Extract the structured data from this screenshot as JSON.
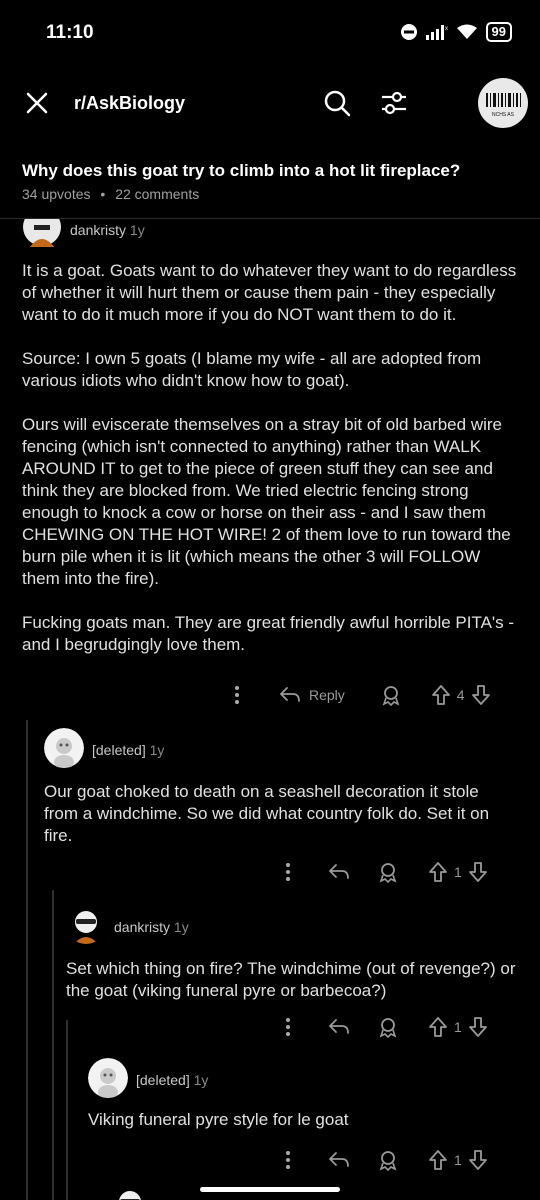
{
  "status": {
    "time": "11:10",
    "battery": "99"
  },
  "nav": {
    "subreddit": "r/AskBiology"
  },
  "post": {
    "title": "Why does this goat try to climb into a hot lit fireplace?",
    "upvotes": "34 upvotes",
    "separator": "•",
    "comments": "22 comments"
  },
  "logo": {
    "text": "NCHS AS"
  },
  "comments": [
    {
      "user": "dankristy",
      "age": "1y",
      "body": "It is a goat. Goats want to do whatever they want to do regardless of whether it will hurt them or cause them pain - they especially want to do it much more if you do NOT want them to do it.\n\nSource: I own 5 goats (I blame my wife - all are adopted from various idiots who didn't know how to goat).\n\nOurs will eviscerate themselves on a stray bit of old barbed wire fencing (which isn't connected to anything) rather than WALK AROUND IT to get to the piece of green stuff they can see and think they are blocked from. We tried electric fencing strong enough to knock a cow or horse on their ass - and I saw them CHEWING ON THE HOT WIRE! 2 of them love to run toward the burn pile when it is lit (which means the other 3 will FOLLOW them into the fire).\n\nFucking goats man. They are great friendly awful horrible PITA's - and I begrudgingly love them.",
      "reply_label": "Reply",
      "votes": "4"
    },
    {
      "user": "[deleted]",
      "age": "1y",
      "body": "Our goat choked to death on a seashell decoration it stole from a windchime. So we did what country folk do. Set it on fire.",
      "votes": "1"
    },
    {
      "user": "dankristy",
      "age": "1y",
      "body": "Set which thing on fire? The windchime (out of revenge?) or the goat (viking funeral pyre or barbecoa?)",
      "votes": "1"
    },
    {
      "user": "[deleted]",
      "age": "1y",
      "body": "Viking funeral pyre style for le goat",
      "votes": "1"
    }
  ]
}
